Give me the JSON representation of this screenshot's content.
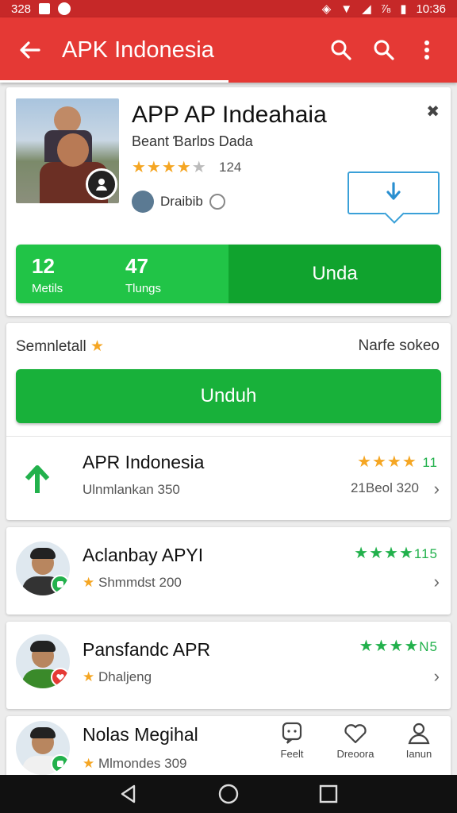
{
  "status": {
    "left_text": "328",
    "right_text": "10:36",
    "signal_text": "⅞"
  },
  "appbar": {
    "title": "APK Indonesia",
    "accent": "#e53935",
    "icons": [
      "back-arrow-icon",
      "search-icon",
      "search-icon",
      "more-vert-icon"
    ]
  },
  "app": {
    "name": "APP AP Indeahaia",
    "developer": "Beant Ɓarlɒs Dada",
    "rating_count": "124",
    "author": "Draibib",
    "stat1_value": "12",
    "stat1_label": "Metils",
    "stat2_value": "47",
    "stat2_label": "Tlungs",
    "action_label": "Unda",
    "star_rating": 4
  },
  "download": {
    "left_label": "Semnletall",
    "right_label": "Narfe sokeo",
    "button_label": "Unduh",
    "item": {
      "title": "APR Indonesia",
      "subtitle": "Ulnmlankan 350",
      "rating_num": "11",
      "count": "21Beol 320"
    }
  },
  "list": [
    {
      "title": "Aclanbay APYI",
      "subtitle": "Shmmdst 200",
      "rating_num": "115",
      "badge_color": "#22b14c"
    },
    {
      "title": "Pansfandc APR",
      "subtitle": "Dhaljeng",
      "rating_num": "N5",
      "badge_color": "#e53935"
    },
    {
      "title": "Nolas Megihal",
      "subtitle": "Mlmondes 309",
      "rating_num": "",
      "badge_color": "#22b14c"
    }
  ],
  "bottom_nav": [
    {
      "label": "Feelt",
      "icon": "chat-icon"
    },
    {
      "label": "Dreoora",
      "icon": "heart-icon"
    },
    {
      "label": "Ianun",
      "icon": "person-icon"
    }
  ],
  "colors": {
    "green": "#21c447",
    "dark_green": "#10a32e",
    "star": "#f5a623",
    "rating_green": "#22b14c"
  }
}
